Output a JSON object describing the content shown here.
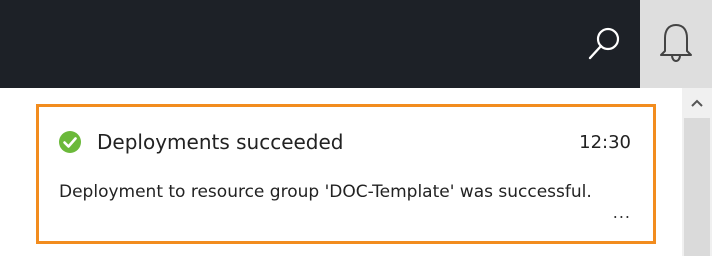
{
  "topbar": {
    "search_icon": "search-icon",
    "notifications_icon": "bell-icon"
  },
  "scrollbar": {
    "up_icon": "chevron-up-icon"
  },
  "notification": {
    "status_icon": "success-check-icon",
    "status_color": "#6bb93a",
    "border_color": "#f28c1e",
    "title": "Deployments succeeded",
    "time": "12:30",
    "message": "Deployment to resource group 'DOC-Template' was successful.",
    "more_label": "..."
  }
}
